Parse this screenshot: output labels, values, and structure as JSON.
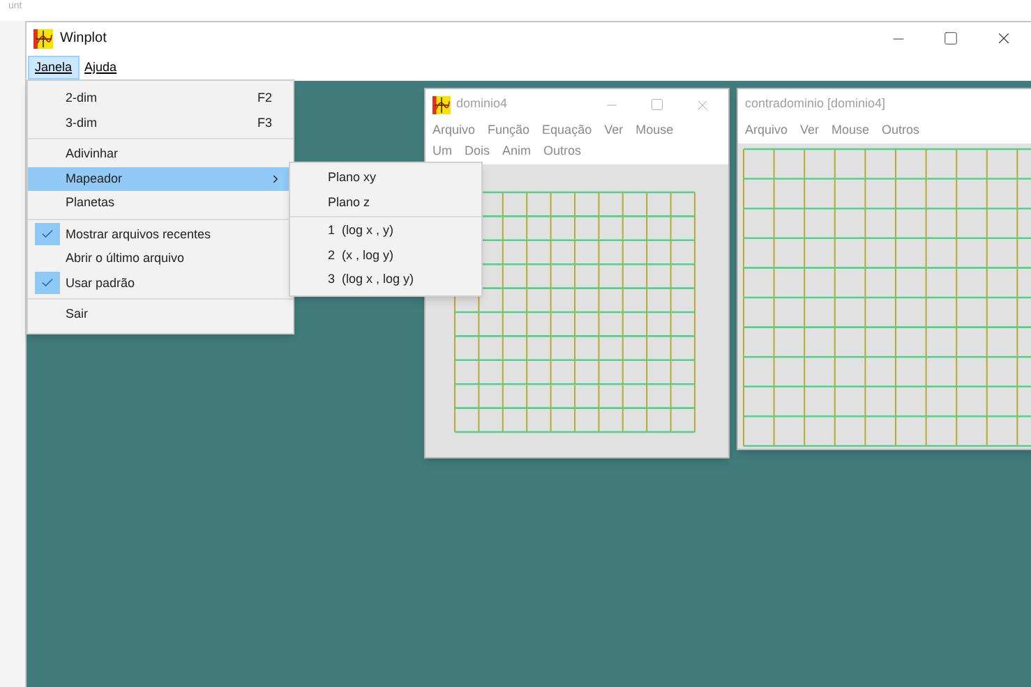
{
  "background_app": {
    "fragment": "unt"
  },
  "window": {
    "title": "Winplot"
  },
  "menubar": [
    {
      "label": "Janela",
      "selected": true
    },
    {
      "label": "Ajuda",
      "selected": false
    }
  ],
  "dropdown": {
    "groups": [
      [
        {
          "label": "2-dim",
          "shortcut": "F2",
          "checked": false,
          "selected": false
        },
        {
          "label": "3-dim",
          "shortcut": "F3",
          "checked": false,
          "selected": false
        }
      ],
      [
        {
          "label": "Adivinhar",
          "checked": false,
          "selected": false
        },
        {
          "label": "Mapeador",
          "checked": false,
          "selected": true,
          "submenu": true
        },
        {
          "label": "Planetas",
          "checked": false,
          "selected": false
        }
      ],
      [
        {
          "label": "Mostrar arquivos recentes",
          "checked": true,
          "selected": false
        },
        {
          "label": "Abrir o último arquivo",
          "checked": false,
          "selected": false
        },
        {
          "label": "Usar padrão",
          "checked": true,
          "selected": false
        }
      ],
      [
        {
          "label": "Sair",
          "checked": false,
          "selected": false
        }
      ]
    ]
  },
  "submenu": {
    "groups": [
      [
        "Plano xy",
        "Plano z"
      ],
      [
        "1  (log x , y)",
        "2  (x , log y)",
        "3  (log x , log y)"
      ]
    ]
  },
  "child_windows": [
    {
      "title": "dominio4",
      "has_icon": true,
      "controls": true,
      "menu_rows": [
        [
          "Arquivo",
          "Função",
          "Equação",
          "Ver",
          "Mouse"
        ],
        [
          "Um",
          "Dois",
          "Anim",
          "Outros"
        ]
      ]
    },
    {
      "title": "contradominio [dominio4]",
      "has_icon": false,
      "controls": false,
      "menu_rows": [
        [
          "Arquivo",
          "Ver",
          "Mouse",
          "Outros"
        ]
      ]
    }
  ]
}
